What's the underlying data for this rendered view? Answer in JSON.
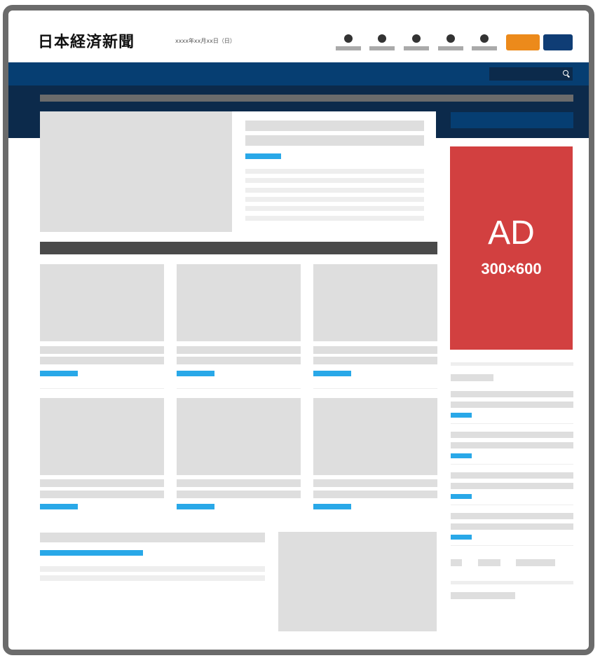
{
  "header": {
    "logo": "日本経済新聞",
    "date": "xxxx年xx月xx日（日）",
    "nav_icons": [
      "nav-icon-1",
      "nav-icon-2",
      "nav-icon-3",
      "nav-icon-4",
      "nav-icon-5"
    ],
    "buttons": [
      {
        "name": "orange-button",
        "color": "#ec8a1b"
      },
      {
        "name": "navy-button",
        "color": "#0f3d75"
      }
    ]
  },
  "nav": {
    "color": "#063e72",
    "search_icon": "search-icon"
  },
  "ad": {
    "label": "AD",
    "size": "300×600",
    "color": "#d24040"
  },
  "colors": {
    "hero_background": "#0c2a4b",
    "tag": "#29a8e8",
    "placeholder": "#dedede",
    "section_bar": "#4a4a4a"
  }
}
